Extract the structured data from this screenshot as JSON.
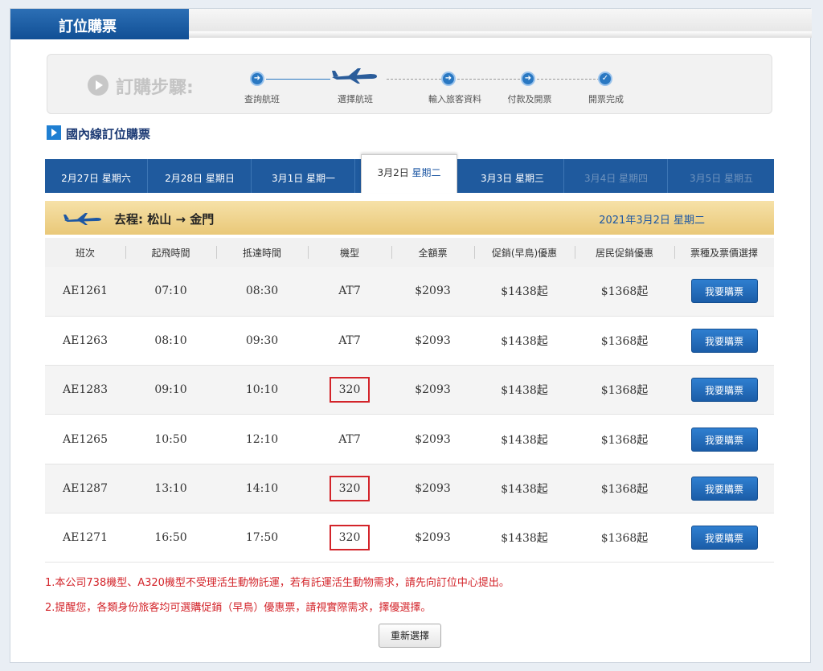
{
  "header": {
    "title": "訂位購票"
  },
  "steps": {
    "label": "訂購步驟:",
    "items": [
      "查詢航班",
      "選擇航班",
      "輸入旅客資料",
      "付款及開票",
      "開票完成"
    ]
  },
  "section": {
    "title": "國內線訂位購票"
  },
  "date_tabs": [
    {
      "date": "2月27日",
      "weekday": "星期六"
    },
    {
      "date": "2月28日",
      "weekday": "星期日"
    },
    {
      "date": "3月1日",
      "weekday": "星期一"
    },
    {
      "date": "3月2日",
      "weekday": "星期二"
    },
    {
      "date": "3月3日",
      "weekday": "星期三"
    },
    {
      "date": "3月4日",
      "weekday": "星期四"
    },
    {
      "date": "3月5日",
      "weekday": "星期五"
    }
  ],
  "route": {
    "label": "去程: 松山 → 金門",
    "date": "2021年3月2日 星期二"
  },
  "table": {
    "headers": [
      "班次",
      "起飛時間",
      "抵達時間",
      "機型",
      "全額票",
      "促銷(早鳥)優惠",
      "居民促銷優惠",
      "票種及票價選擇"
    ],
    "rows": [
      {
        "flight": "AE1261",
        "dep": "07:10",
        "arr": "08:30",
        "aircraft": "AT7",
        "full": "$2093",
        "promo": "$1438起",
        "resident": "$1368起",
        "buy": "我要購票"
      },
      {
        "flight": "AE1263",
        "dep": "08:10",
        "arr": "09:30",
        "aircraft": "AT7",
        "full": "$2093",
        "promo": "$1438起",
        "resident": "$1368起",
        "buy": "我要購票"
      },
      {
        "flight": "AE1283",
        "dep": "09:10",
        "arr": "10:10",
        "aircraft": "320",
        "full": "$2093",
        "promo": "$1438起",
        "resident": "$1368起",
        "buy": "我要購票"
      },
      {
        "flight": "AE1265",
        "dep": "10:50",
        "arr": "12:10",
        "aircraft": "AT7",
        "full": "$2093",
        "promo": "$1438起",
        "resident": "$1368起",
        "buy": "我要購票"
      },
      {
        "flight": "AE1287",
        "dep": "13:10",
        "arr": "14:10",
        "aircraft": "320",
        "full": "$2093",
        "promo": "$1438起",
        "resident": "$1368起",
        "buy": "我要購票"
      },
      {
        "flight": "AE1271",
        "dep": "16:50",
        "arr": "17:50",
        "aircraft": "320",
        "full": "$2093",
        "promo": "$1438起",
        "resident": "$1368起",
        "buy": "我要購票"
      }
    ]
  },
  "notes": [
    "1.本公司738機型、A320機型不受理活生動物託運，若有託運活生動物需求，請先向訂位中心提出。",
    "2.提醒您，各類身份旅客均可選購促銷（早鳥）優惠票，請視實際需求，擇優選擇。"
  ],
  "reset_label": "重新選擇",
  "colors": {
    "header_blue": "#1b5da8",
    "price_orange": "#e07a16",
    "highlight_red": "#d3242a"
  }
}
